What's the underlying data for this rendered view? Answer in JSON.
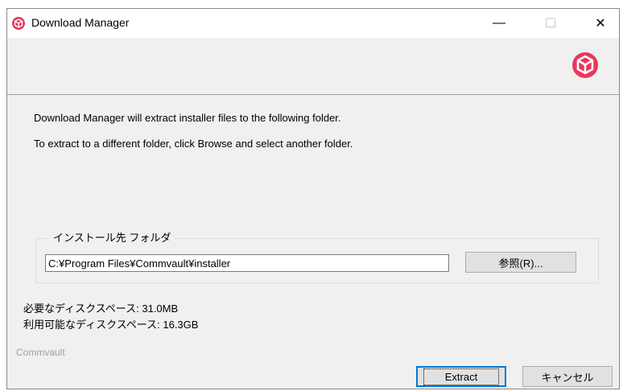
{
  "window": {
    "title": "Download Manager",
    "minimize_glyph": "—",
    "maximize_glyph": "☐",
    "close_glyph": "✕",
    "icon": "commvault-cube-icon",
    "brand_color": "#e8375a"
  },
  "content": {
    "message_line1": "Download Manager will extract installer files to the following folder.",
    "message_line2": "To extract to a different folder, click Browse and select another folder.",
    "folder_group_label": "インストール先 フォルダ",
    "install_path": "C:¥Program Files¥Commvault¥installer",
    "browse_label": "参照(R)...",
    "required_space": "必要なディスクスペース: 31.0MB",
    "available_space": "利用可能なディスクスペース: 16.3GB",
    "brand_label": "Commvault"
  },
  "buttons": {
    "extract_label": "Extract",
    "cancel_label": "キャンセル"
  }
}
